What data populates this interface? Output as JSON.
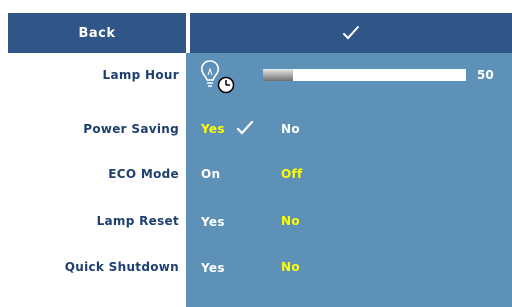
{
  "header": {
    "back_label": "Back",
    "confirm_icon": "check-icon"
  },
  "menu": {
    "lamp_hour": {
      "label": "Lamp Hour",
      "icon": "lamp-clock-icon",
      "value": "50",
      "progress_fraction": 0.15
    },
    "power_saving": {
      "label": "Power Saving",
      "options": [
        "Yes",
        "No"
      ],
      "selected": "Yes"
    },
    "eco_mode": {
      "label": "ECO Mode",
      "options": [
        "On",
        "Off"
      ],
      "selected": "Off"
    },
    "lamp_reset": {
      "label": "Lamp Reset",
      "options": [
        "Yes",
        "No"
      ],
      "selected": "No"
    },
    "quick_shutdown": {
      "label": "Quick Shutdown",
      "options": [
        "Yes",
        "No"
      ],
      "selected": "No"
    }
  },
  "colors": {
    "header_bg": "#2f5687",
    "panel_bg": "#5e91b7",
    "label_text": "#1e3f70",
    "selected_text": "#ffff00",
    "unselected_text": "#ffffff"
  }
}
